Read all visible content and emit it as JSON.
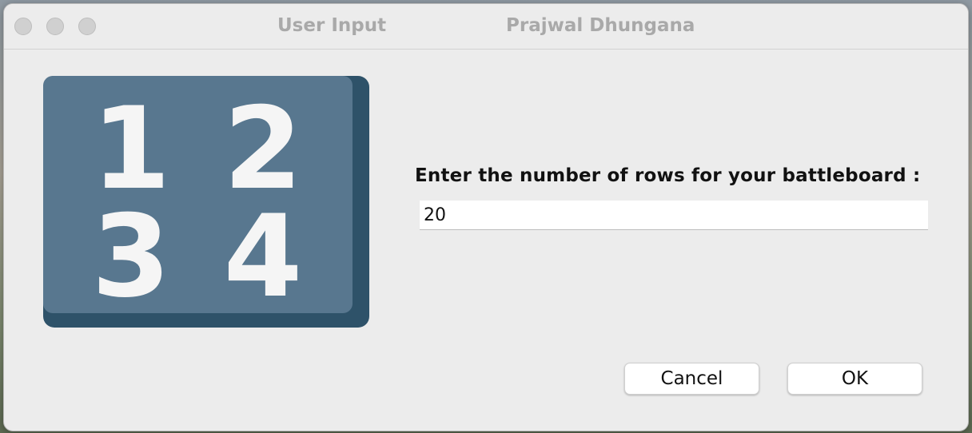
{
  "window": {
    "title": "User Input",
    "subtitle": "Prajwal Dhungana"
  },
  "icon": {
    "name": "numbers-1234-icon",
    "digits": [
      "1",
      "2",
      "3",
      "4"
    ],
    "tile_color": "#58778f",
    "tile_shadow_color": "#2e5269",
    "digit_color": "#f5f5f5"
  },
  "prompt": {
    "label": "Enter the number of rows for your battleboard :"
  },
  "input": {
    "value": "20"
  },
  "buttons": {
    "cancel_label": "Cancel",
    "ok_label": "OK"
  }
}
